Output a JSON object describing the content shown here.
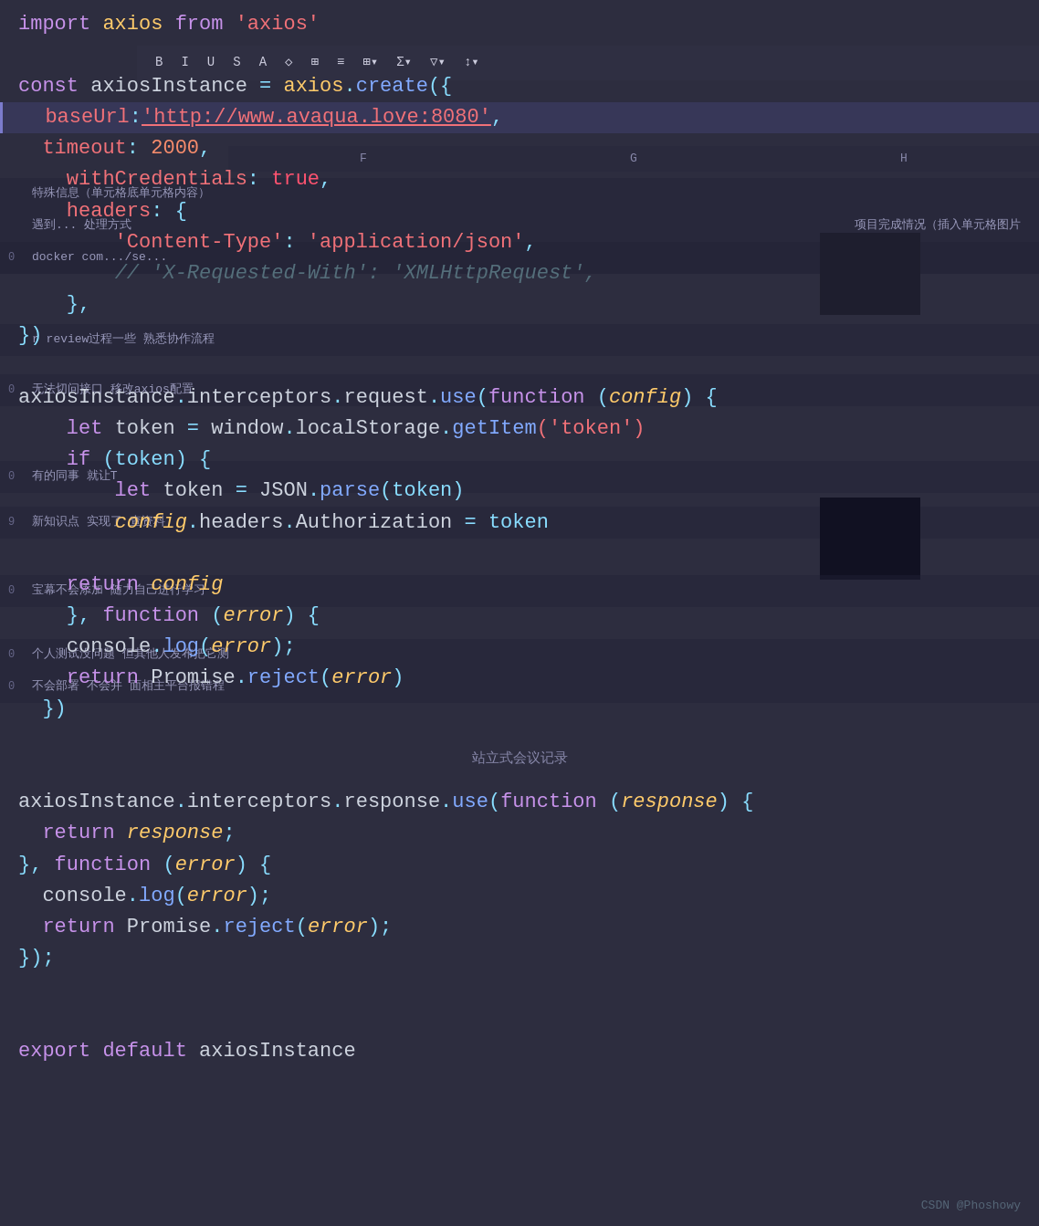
{
  "code": {
    "lines": [
      {
        "id": 1,
        "tokens": [
          {
            "text": "import ",
            "class": "kw"
          },
          {
            "text": "axios ",
            "class": "axios-name"
          },
          {
            "text": "from ",
            "class": "kw"
          },
          {
            "text": "'axios'",
            "class": "str"
          }
        ]
      },
      {
        "id": 2,
        "tokens": []
      },
      {
        "id": 3,
        "tokens": [
          {
            "text": "const ",
            "class": "kw"
          },
          {
            "text": "axiosInstance ",
            "class": "prop"
          },
          {
            "text": "= ",
            "class": "teal"
          },
          {
            "text": "axios",
            "class": "axios-name"
          },
          {
            "text": ".",
            "class": "punct"
          },
          {
            "text": "create",
            "class": "fn"
          },
          {
            "text": "({",
            "class": "teal"
          }
        ]
      },
      {
        "id": 4,
        "tokens": [
          {
            "text": "  baseUrl",
            "class": "key"
          },
          {
            "text": ":",
            "class": "teal"
          },
          {
            "text": "'http://www.avaqua.love:8080'",
            "class": "str-url"
          },
          {
            "text": ",",
            "class": "teal"
          }
        ],
        "highlight": true
      },
      {
        "id": 5,
        "tokens": [
          {
            "text": "  timeout",
            "class": "key"
          },
          {
            "text": ": ",
            "class": "teal"
          },
          {
            "text": "2000",
            "class": "num"
          },
          {
            "text": ",",
            "class": "teal"
          }
        ]
      },
      {
        "id": 6,
        "tokens": [
          {
            "text": "    withCredentials",
            "class": "key"
          },
          {
            "text": ": ",
            "class": "teal"
          },
          {
            "text": "true",
            "class": "bool"
          },
          {
            "text": ",",
            "class": "teal"
          }
        ]
      },
      {
        "id": 7,
        "tokens": [
          {
            "text": "    headers",
            "class": "key"
          },
          {
            "text": ": {",
            "class": "teal"
          }
        ]
      },
      {
        "id": 8,
        "tokens": [
          {
            "text": "        'Content-Type'",
            "class": "str"
          },
          {
            "text": ": ",
            "class": "teal"
          },
          {
            "text": "'application/json'",
            "class": "str"
          },
          {
            "text": ",",
            "class": "teal"
          }
        ]
      },
      {
        "id": 9,
        "tokens": [
          {
            "text": "        ",
            "class": "comment"
          },
          {
            "text": "// 'X-Requested-With': 'XMLHttpRequest',",
            "class": "comment"
          }
        ]
      },
      {
        "id": 10,
        "tokens": [
          {
            "text": "    },",
            "class": "teal"
          }
        ]
      },
      {
        "id": 11,
        "tokens": [
          {
            "text": "})",
            "class": "teal"
          }
        ]
      },
      {
        "id": 12,
        "tokens": []
      },
      {
        "id": 13,
        "tokens": [
          {
            "text": "axiosInstance",
            "class": "prop"
          },
          {
            "text": ".",
            "class": "punct"
          },
          {
            "text": "interceptors",
            "class": "prop"
          },
          {
            "text": ".",
            "class": "punct"
          },
          {
            "text": "request",
            "class": "prop"
          },
          {
            "text": ".",
            "class": "punct"
          },
          {
            "text": "use",
            "class": "fn"
          },
          {
            "text": "(",
            "class": "teal"
          },
          {
            "text": "function ",
            "class": "func-kw"
          },
          {
            "text": "(",
            "class": "teal"
          },
          {
            "text": "config",
            "class": "param"
          },
          {
            "text": ") {",
            "class": "teal"
          }
        ]
      },
      {
        "id": 14,
        "tokens": [
          {
            "text": "    let ",
            "class": "kw"
          },
          {
            "text": "token ",
            "class": "prop"
          },
          {
            "text": "= ",
            "class": "teal"
          },
          {
            "text": "window",
            "class": "prop"
          },
          {
            "text": ".",
            "class": "punct"
          },
          {
            "text": "localStorage",
            "class": "prop"
          },
          {
            "text": ".",
            "class": "punct"
          },
          {
            "text": "getItem",
            "class": "fn"
          },
          {
            "text": "('token')",
            "class": "str"
          }
        ]
      },
      {
        "id": 15,
        "tokens": [
          {
            "text": "    if ",
            "class": "kw"
          },
          {
            "text": "(token) {",
            "class": "teal"
          }
        ]
      },
      {
        "id": 16,
        "tokens": [
          {
            "text": "        let ",
            "class": "kw"
          },
          {
            "text": "token ",
            "class": "prop"
          },
          {
            "text": "= ",
            "class": "teal"
          },
          {
            "text": "JSON",
            "class": "prop"
          },
          {
            "text": ".",
            "class": "punct"
          },
          {
            "text": "parse",
            "class": "fn"
          },
          {
            "text": "(token)",
            "class": "teal"
          }
        ]
      },
      {
        "id": 17,
        "tokens": [
          {
            "text": "        ",
            "class": ""
          },
          {
            "text": "config",
            "class": "param"
          },
          {
            "text": ".",
            "class": "punct"
          },
          {
            "text": "headers",
            "class": "prop"
          },
          {
            "text": ".",
            "class": "punct"
          },
          {
            "text": "Authorization ",
            "class": "prop"
          },
          {
            "text": "= token",
            "class": "teal"
          }
        ]
      },
      {
        "id": 18,
        "tokens": []
      },
      {
        "id": 19,
        "tokens": [
          {
            "text": "    return ",
            "class": "kw"
          },
          {
            "text": "config",
            "class": "param"
          }
        ]
      },
      {
        "id": 20,
        "tokens": [
          {
            "text": "    }, ",
            "class": "teal"
          },
          {
            "text": "function ",
            "class": "func-kw"
          },
          {
            "text": "(",
            "class": "teal"
          },
          {
            "text": "error",
            "class": "param"
          },
          {
            "text": ") {",
            "class": "teal"
          }
        ]
      },
      {
        "id": 21,
        "tokens": [
          {
            "text": "    console",
            "class": "prop"
          },
          {
            "text": ".",
            "class": "punct"
          },
          {
            "text": "log",
            "class": "fn"
          },
          {
            "text": "(",
            "class": "teal"
          },
          {
            "text": "error",
            "class": "param"
          },
          {
            "text": ");",
            "class": "teal"
          }
        ]
      },
      {
        "id": 22,
        "tokens": [
          {
            "text": "    return ",
            "class": "kw"
          },
          {
            "text": "Promise",
            "class": "prop"
          },
          {
            "text": ".",
            "class": "punct"
          },
          {
            "text": "reject",
            "class": "fn"
          },
          {
            "text": "(",
            "class": "teal"
          },
          {
            "text": "error",
            "class": "param"
          },
          {
            "text": ")",
            "class": "teal"
          }
        ]
      },
      {
        "id": 23,
        "tokens": [
          {
            "text": "  })",
            "class": "teal"
          }
        ]
      },
      {
        "id": 24,
        "tokens": []
      },
      {
        "id": 25,
        "tokens": []
      },
      {
        "id": 26,
        "tokens": [
          {
            "text": "axiosInstance",
            "class": "prop"
          },
          {
            "text": ".",
            "class": "punct"
          },
          {
            "text": "interceptors",
            "class": "prop"
          },
          {
            "text": ".",
            "class": "punct"
          },
          {
            "text": "response",
            "class": "prop"
          },
          {
            "text": ".",
            "class": "punct"
          },
          {
            "text": "use",
            "class": "fn"
          },
          {
            "text": "(",
            "class": "teal"
          },
          {
            "text": "function ",
            "class": "func-kw"
          },
          {
            "text": "(",
            "class": "teal"
          },
          {
            "text": "response",
            "class": "param"
          },
          {
            "text": ") {",
            "class": "teal"
          }
        ]
      },
      {
        "id": 27,
        "tokens": [
          {
            "text": "  return ",
            "class": "kw"
          },
          {
            "text": "response",
            "class": "param"
          },
          {
            "text": ";",
            "class": "teal"
          }
        ]
      },
      {
        "id": 28,
        "tokens": [
          {
            "text": "}, ",
            "class": "teal"
          },
          {
            "text": "function ",
            "class": "func-kw"
          },
          {
            "text": "(",
            "class": "teal"
          },
          {
            "text": "error",
            "class": "param"
          },
          {
            "text": ") {",
            "class": "teal"
          }
        ]
      },
      {
        "id": 29,
        "tokens": [
          {
            "text": "  console",
            "class": "prop"
          },
          {
            "text": ".",
            "class": "punct"
          },
          {
            "text": "log",
            "class": "fn"
          },
          {
            "text": "(",
            "class": "teal"
          },
          {
            "text": "error",
            "class": "param"
          },
          {
            "text": ");",
            "class": "teal"
          }
        ]
      },
      {
        "id": 30,
        "tokens": [
          {
            "text": "  return ",
            "class": "kw"
          },
          {
            "text": "Promise",
            "class": "prop"
          },
          {
            "text": ".",
            "class": "punct"
          },
          {
            "text": "reject",
            "class": "fn"
          },
          {
            "text": "(",
            "class": "teal"
          },
          {
            "text": "error",
            "class": "param"
          },
          {
            "text": ");",
            "class": "teal"
          }
        ]
      },
      {
        "id": 31,
        "tokens": [
          {
            "text": "});",
            "class": "teal"
          }
        ]
      },
      {
        "id": 32,
        "tokens": []
      },
      {
        "id": 33,
        "tokens": []
      },
      {
        "id": 34,
        "tokens": [
          {
            "text": "export ",
            "class": "kw"
          },
          {
            "text": "default ",
            "class": "kw"
          },
          {
            "text": "axiosInstance",
            "class": "prop"
          }
        ]
      }
    ]
  },
  "overlay": {
    "toolbar_items": [
      "B",
      "I",
      "U",
      "S",
      "A",
      "◇",
      "⊞",
      "≡",
      "⊞",
      "Σ",
      "▽",
      "↕"
    ],
    "col_headers": [
      "F",
      "G",
      "H"
    ],
    "rows": [
      {
        "num": "",
        "text": "特殊信息（单元格底单元格内容）"
      },
      {
        "num": "",
        "text": "遇到... 处理方式",
        "extra": "项目完成情况（插入单元格图片"
      },
      {
        "num": "0",
        "text": "docker com.../se..."
      },
      {
        "num": "",
        "text": "r review过程一些 熟悉协作流程"
      },
      {
        "num": "0",
        "text": "无法切问接口  移改axios配置"
      },
      {
        "num": "0",
        "text": "有的同事 就让T"
      },
      {
        "num": "9",
        "text": "新知识点 实现了 查资料"
      },
      {
        "num": "0",
        "text": "宝幕不会添加  随力自己进行学习"
      },
      {
        "num": "0",
        "text": "个人测试没问题 但其他人发布把它测"
      },
      {
        "num": "0",
        "text": "不会部署 不会并 面相主平台报错程"
      }
    ],
    "meeting_text": "站立式会议记录",
    "watermark": "CSDN @Phoshowy"
  }
}
